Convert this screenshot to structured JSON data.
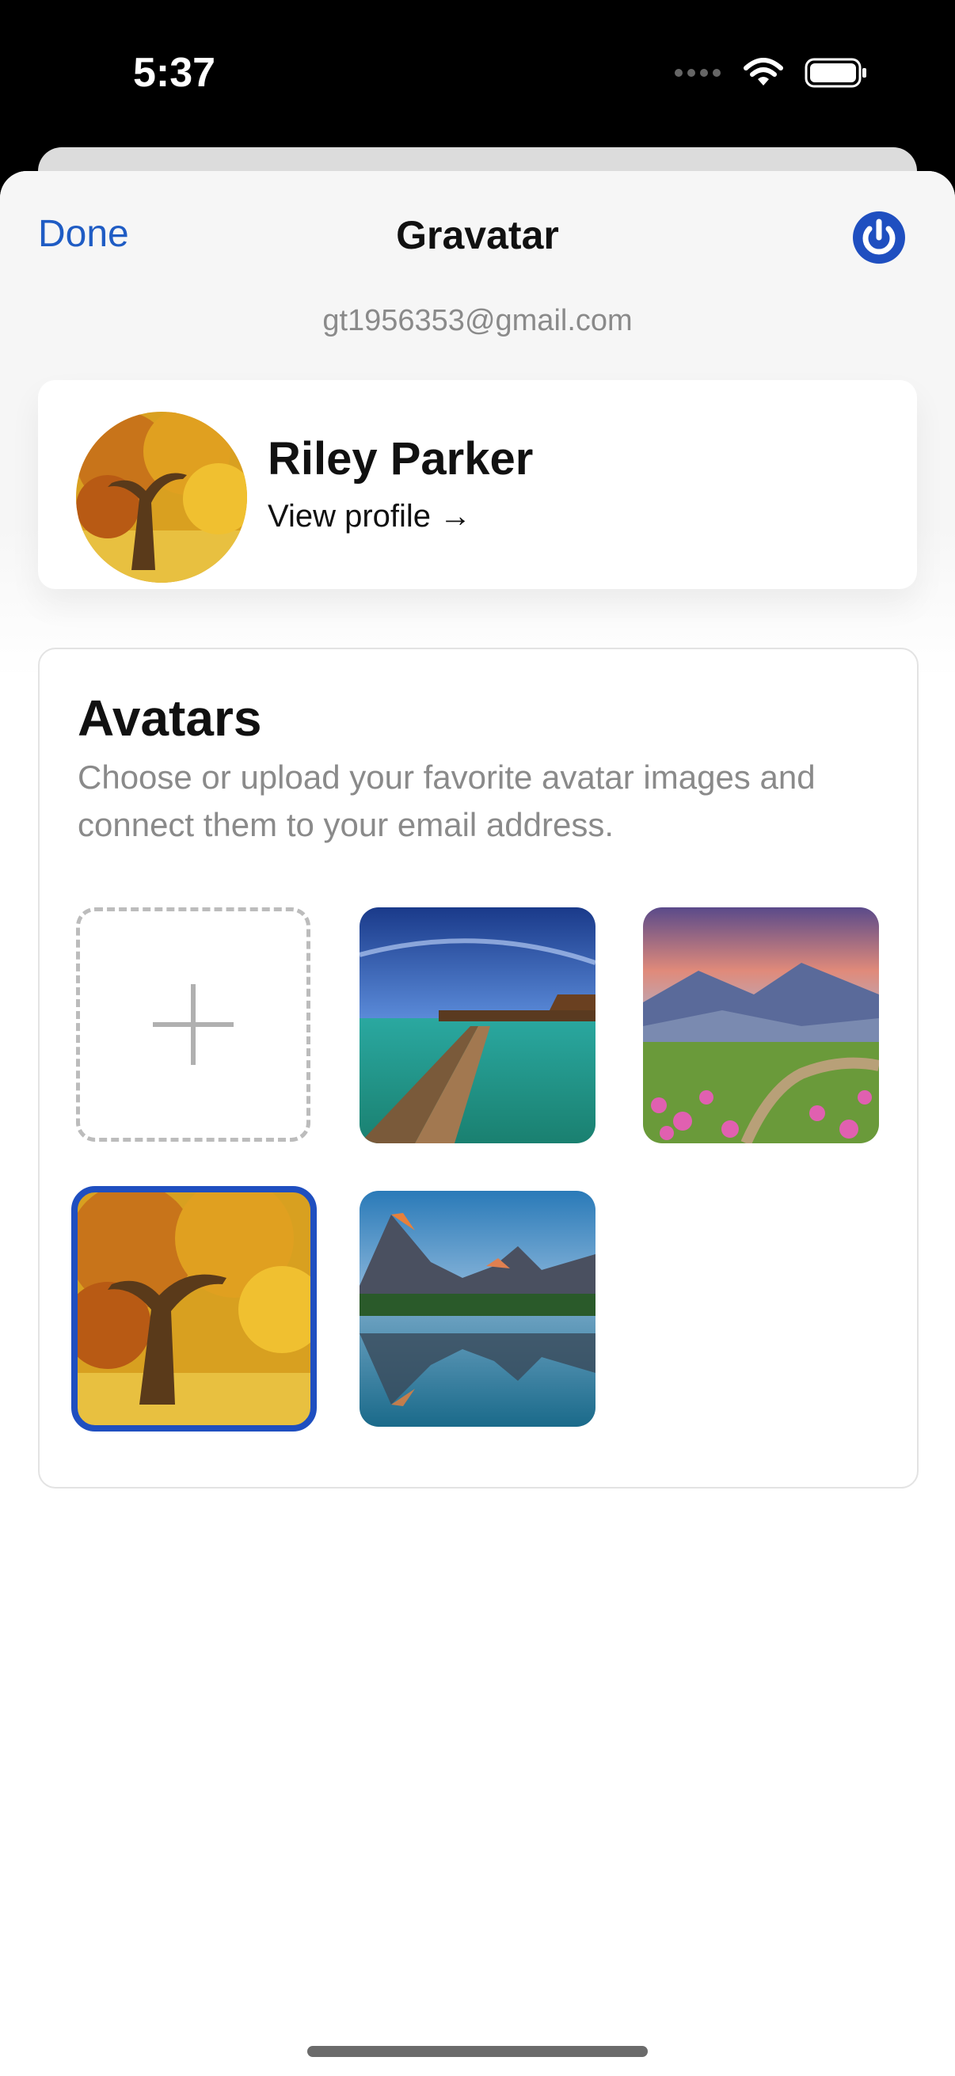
{
  "status_bar": {
    "time": "5:37"
  },
  "nav": {
    "done_label": "Done",
    "title": "Gravatar"
  },
  "account": {
    "email": "gt1956353@gmail.com"
  },
  "profile": {
    "name": "Riley Parker",
    "link_label": "View profile →"
  },
  "avatars": {
    "title": "Avatars",
    "description": "Choose or upload your favorite avatar images and connect them to your email address.",
    "items": [
      {
        "kind": "upload",
        "icon": "plus-icon"
      },
      {
        "kind": "image",
        "subject": "pier",
        "selected": false
      },
      {
        "kind": "image",
        "subject": "mountain-meadow",
        "selected": false
      },
      {
        "kind": "image",
        "subject": "autumn-tree",
        "selected": true
      },
      {
        "kind": "image",
        "subject": "mountain-lake",
        "selected": false
      }
    ]
  },
  "colors": {
    "accent": "#1f5cc4",
    "selected_border": "#1f4fc0",
    "secondary_text": "#8a8a8a"
  }
}
